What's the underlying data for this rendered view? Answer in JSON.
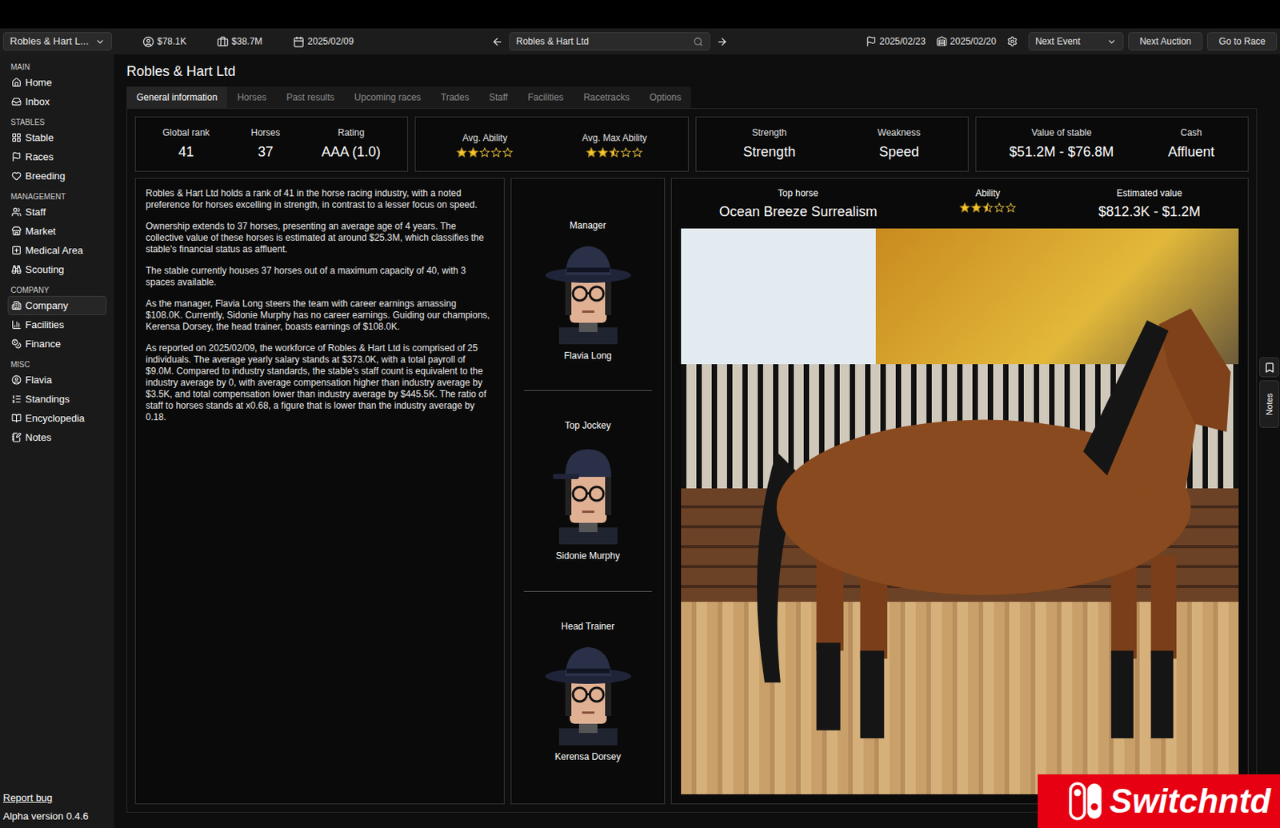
{
  "topbar": {
    "company_select": "Robles & Hart L...",
    "cash": "$78.1K",
    "funds": "$38.7M",
    "date": "2025/02/09",
    "search_value": "Robles & Hart Ltd",
    "next_race_date": "2025/02/23",
    "next_auction_date": "2025/02/20",
    "event_select": "Next Event",
    "buttons": [
      "Next Auction",
      "Go to Race"
    ]
  },
  "sidebar": {
    "sections": [
      {
        "title": "MAIN",
        "items": [
          {
            "label": "Home",
            "selected": false
          },
          {
            "label": "Inbox",
            "selected": false
          }
        ]
      },
      {
        "title": "STABLES",
        "items": [
          {
            "label": "Stable",
            "selected": false
          },
          {
            "label": "Races",
            "selected": false
          },
          {
            "label": "Breeding",
            "selected": false
          }
        ]
      },
      {
        "title": "MANAGEMENT",
        "items": [
          {
            "label": "Staff",
            "selected": false
          },
          {
            "label": "Market",
            "selected": false
          },
          {
            "label": "Medical Area",
            "selected": false
          },
          {
            "label": "Scouting",
            "selected": false
          }
        ]
      },
      {
        "title": "COMPANY",
        "items": [
          {
            "label": "Company",
            "selected": true
          },
          {
            "label": "Facilities",
            "selected": false
          },
          {
            "label": "Finance",
            "selected": false
          }
        ]
      },
      {
        "title": "MISC",
        "items": [
          {
            "label": "Flavia",
            "selected": false
          },
          {
            "label": "Standings",
            "selected": false
          },
          {
            "label": "Encyclopedia",
            "selected": false
          },
          {
            "label": "Notes",
            "selected": false
          }
        ]
      }
    ],
    "footer_link": "Report bug",
    "version": "Alpha version 0.4.6"
  },
  "page_title": "Robles & Hart Ltd",
  "tabs": [
    {
      "label": "General information",
      "selected": true
    },
    {
      "label": "Horses",
      "selected": false
    },
    {
      "label": "Past results",
      "selected": false
    },
    {
      "label": "Upcoming races",
      "selected": false
    },
    {
      "label": "Trades",
      "selected": false
    },
    {
      "label": "Staff",
      "selected": false
    },
    {
      "label": "Facilities",
      "selected": false
    },
    {
      "label": "Racetracks",
      "selected": false
    },
    {
      "label": "Options",
      "selected": false
    }
  ],
  "stat_cards": [
    {
      "kind": "text",
      "stats": [
        {
          "label": "Global rank",
          "value": "41"
        },
        {
          "label": "Horses",
          "value": "37"
        },
        {
          "label": "Rating",
          "value": "AAA (1.0)"
        }
      ]
    },
    {
      "kind": "stars",
      "stats": [
        {
          "label": "Avg. Ability",
          "stars": 2
        },
        {
          "label": "Avg. Max Ability",
          "stars": 2.5
        }
      ]
    },
    {
      "kind": "text",
      "stats": [
        {
          "label": "Strength",
          "value": "Strength"
        },
        {
          "label": "Weakness",
          "value": "Speed"
        }
      ]
    },
    {
      "kind": "text",
      "stats": [
        {
          "label": "Value of stable",
          "value": "$51.2M - $76.8M"
        },
        {
          "label": "Cash",
          "value": "Affluent"
        }
      ]
    }
  ],
  "description": [
    "Robles & Hart Ltd holds a rank of 41 in the horse racing industry, with a noted preference for horses excelling in strength, in contrast to a lesser focus on speed.",
    "Ownership extends to 37 horses, presenting an average age of 4 years. The collective value of these horses is estimated at around $25.3M, which classifies the stable's financial status as affluent.",
    "The stable currently houses 37 horses out of a maximum capacity of 40, with 3 spaces available.",
    "As the manager, Flavia Long steers the team with career earnings amassing $108.0K. Currently, Sidonie Murphy has no career earnings. Guiding our champions, Kerensa Dorsey, the head trainer, boasts earnings of $108.0K.",
    "As reported on 2025/02/09, the workforce of Robles & Hart Ltd is comprised of 25 individuals. The average yearly salary stands at $373.0K, with a total payroll of $9.0M. Compared to industry standards, the stable's staff count is equivalent to the industry average by 0, with average compensation higher than industry average by $3.5K, and total compensation lower than industry average by $445.5K. The ratio of staff to horses stands at x0.68, a figure that is lower than the industry average by 0.18."
  ],
  "people": [
    {
      "role": "Manager",
      "name": "Flavia Long",
      "kind": "cowboy"
    },
    {
      "role": "Top Jockey",
      "name": "Sidonie Murphy",
      "kind": "cap"
    },
    {
      "role": "Head Trainer",
      "name": "Kerensa Dorsey",
      "kind": "cowboy"
    }
  ],
  "top_horse": {
    "label": "Top horse",
    "name": "Ocean Breeze Surrealism",
    "ability_label": "Ability",
    "stars": 2.5,
    "value_label": "Estimated value",
    "value": "$812.3K - $1.2M"
  },
  "notes_tab": "Notes",
  "watermark": "Switchntd"
}
